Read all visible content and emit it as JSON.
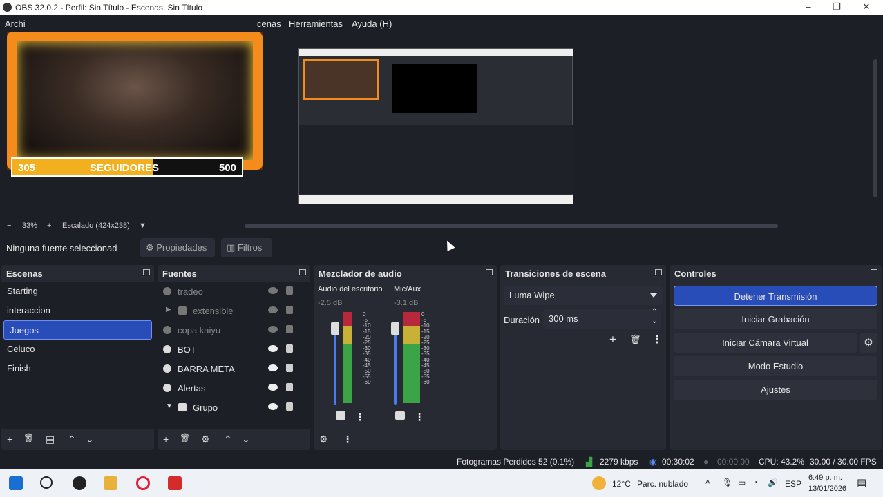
{
  "titlebar": {
    "title": "OBS 32.0.2 - Perfil: Sin Título - Escenas: Sin Título",
    "minimize": "–",
    "maximize": "❐",
    "close": "✕"
  },
  "menu": {
    "archivo": "Archi",
    "escenas": "cenas",
    "herramientas": "Herramientas",
    "ayuda": "Ayuda (H)"
  },
  "overlay": {
    "left_count": "305",
    "label": "SEGUIDORES",
    "goal": "500",
    "progress": 0.61
  },
  "zoom": {
    "minus": "−",
    "value": "33%",
    "plus": "+",
    "scaling": "Escalado (424x238)",
    "arrow": "▼"
  },
  "sourcebar": {
    "no_selection": "Ninguna fuente seleccionad",
    "properties": "Propiedades",
    "filters": "Filtros"
  },
  "scenes": {
    "title": "Escenas",
    "items": [
      "Starting",
      "interaccion",
      "Juegos",
      "Celuco",
      "Finish"
    ],
    "selected": 2,
    "footer": {
      "add": "+",
      "remove": "🗑",
      "filter": "▤",
      "up": "⌃",
      "down": "⌄"
    }
  },
  "sources": {
    "title": "Fuentes",
    "items": [
      {
        "label": "tradeo",
        "hidden": true
      },
      {
        "label": "extensible",
        "hidden": true,
        "folder": true,
        "expander": "▶"
      },
      {
        "label": "copa kaiyu",
        "hidden": true
      },
      {
        "label": "BOT",
        "hidden": false
      },
      {
        "label": "BARRA META",
        "hidden": false
      },
      {
        "label": "Alertas",
        "hidden": false
      },
      {
        "label": "Grupo",
        "hidden": false,
        "folder": true,
        "expander": "▼"
      }
    ],
    "footer": {
      "add": "+",
      "remove": "🗑",
      "settings": "⚙",
      "up": "⌃",
      "down": "⌄"
    }
  },
  "mixer": {
    "title": "Mezclador de audio",
    "channels": [
      {
        "name": "Audio del escritorio",
        "db": "-2.5 dB",
        "level": 0.82
      },
      {
        "name": "Mic/Aux",
        "db": "-3.1 dB",
        "level": 0.85
      }
    ],
    "scale": [
      "0",
      "-5",
      "-10",
      "-15",
      "-20",
      "-25",
      "-30",
      "-35",
      "-40",
      "-45",
      "-50",
      "-55",
      "-60"
    ],
    "menu": "⋮",
    "footer": {
      "settings": "⚙",
      "menu": "⋮"
    }
  },
  "transitions": {
    "title": "Transiciones de escena",
    "selected": "Luma Wipe",
    "duration_label": "Duración",
    "duration_value": "300 ms",
    "add": "+",
    "remove": "🗑",
    "menu": "⋮",
    "up": "⌃",
    "down": "⌄"
  },
  "controls": {
    "title": "Controles",
    "stop_stream": "Detener Transmisión",
    "start_recording": "Iniciar Grabación",
    "start_virtual_cam": "Iniciar Cámara Virtual",
    "studio_mode": "Modo Estudio",
    "settings": "Ajustes",
    "gear": "⚙"
  },
  "status": {
    "dropped_frames": "Fotogramas Perdidos 52 (0.1%)",
    "bitrate": "2279 kbps",
    "stream_time": "00:30:02",
    "rec_time": "00:00:00",
    "cpu": "CPU: 43.2%",
    "fps": "30.00 / 30.00 FPS"
  },
  "taskbar": {
    "temp": "12°C",
    "weather": "Parc. nublado",
    "caret": "^",
    "lang": "ESP",
    "time": "6:49 p. m.",
    "date": "13/01/2026"
  },
  "colors": {
    "accent": "#284cb8",
    "panel": "#272a33",
    "background": "#1d1f26"
  }
}
